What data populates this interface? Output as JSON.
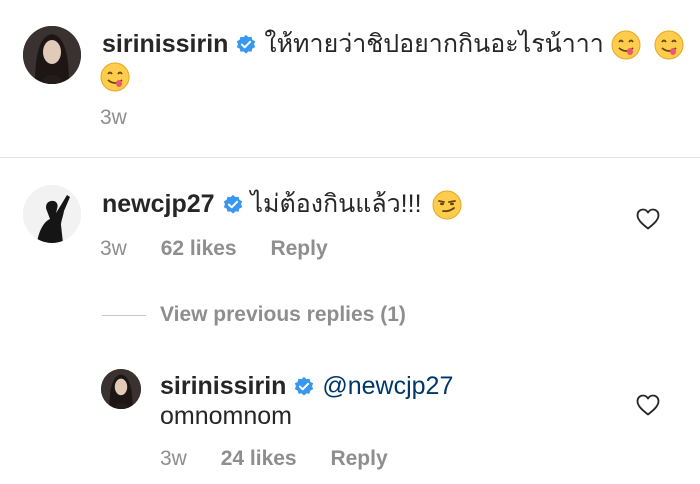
{
  "caption": {
    "username": "sirinissirin",
    "text": "ให้ทายว่าชิปอยากกินอะไรน้าาา",
    "time": "3w"
  },
  "comment": {
    "username": "newcjp27",
    "text": "ไม่ต้องกินแล้ว!!!",
    "time": "3w",
    "likes": "62 likes",
    "reply_label": "Reply"
  },
  "view_replies": {
    "label": "View previous replies (1)"
  },
  "reply": {
    "username": "sirinissirin",
    "mention": "@newcjp27",
    "text": "omnomnom",
    "time": "3w",
    "likes": "24 likes",
    "reply_label": "Reply"
  },
  "colors": {
    "text": "#262626",
    "secondary": "#8e8e8e",
    "verified": "#3897f0",
    "mention": "#00376b",
    "divider": "#e3e3e3"
  },
  "icons": [
    "verified-badge-icon",
    "savoring-face-emoji",
    "smirking-face-emoji",
    "heart-icon"
  ]
}
